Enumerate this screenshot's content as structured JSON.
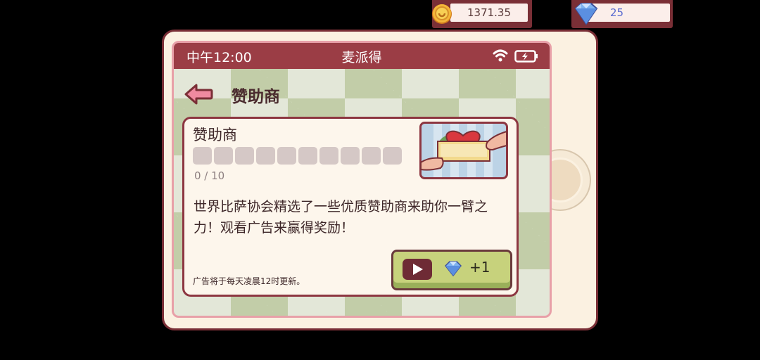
{
  "currency": {
    "coins": "1371.35",
    "gems": "25"
  },
  "status_bar": {
    "time": "中午12:00",
    "title": "麦派得"
  },
  "page": {
    "title": "赞助商"
  },
  "card": {
    "title": "赞助商",
    "progress_text": "0 / 10",
    "progress_current": 0,
    "progress_total": 10,
    "description": "世界比萨协会精选了一些优质赞助商来助你一臂之力！观看广告来赢得奖励！",
    "footnote": "广告将于每天凌晨12时更新。",
    "watch_button": {
      "reward_label": "+1",
      "icon": "play-icon",
      "reward_icon": "diamond-icon"
    }
  },
  "colors": {
    "header": "#9b3d45",
    "card_border": "#8d3641",
    "button_green": "#c7d27c"
  }
}
